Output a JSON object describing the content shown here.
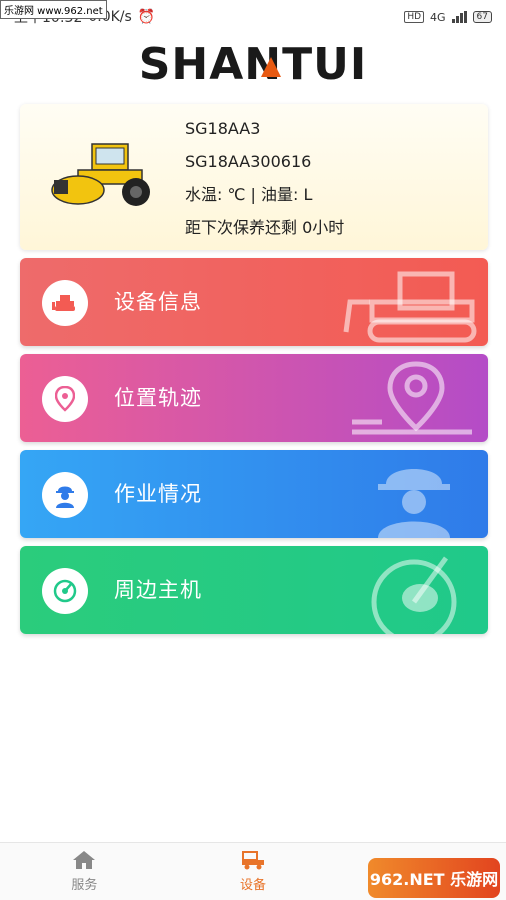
{
  "status": {
    "watermark": "乐游网 www.962.net",
    "time_text": "上午10:32",
    "speed": "0.0K/s",
    "hd": "HD",
    "network": "4G",
    "battery": "67"
  },
  "header": {
    "logo": "SHANTUI"
  },
  "device": {
    "model": "SG18AA3",
    "serial": "SG18AA300616",
    "readings": "水温: ℃ | 油量: L",
    "maintenance": "距下次保养还剩 0小时"
  },
  "menu": {
    "items": [
      {
        "label": "设备信息",
        "icon": "bulldozer-icon"
      },
      {
        "label": "位置轨迹",
        "icon": "location-pin-icon"
      },
      {
        "label": "作业情况",
        "icon": "worker-icon"
      },
      {
        "label": "周边主机",
        "icon": "radar-icon"
      }
    ]
  },
  "tabs": [
    {
      "label": "服务",
      "icon": "home-icon"
    },
    {
      "label": "设备",
      "icon": "vehicle-icon"
    }
  ],
  "watermark_bottom": "962.NET 乐游网",
  "colors": {
    "accent": "#e8742a",
    "menu1": "#f35b53",
    "menu2": "#b44cc7",
    "menu3": "#2f7be9",
    "menu4": "#20c98a"
  }
}
